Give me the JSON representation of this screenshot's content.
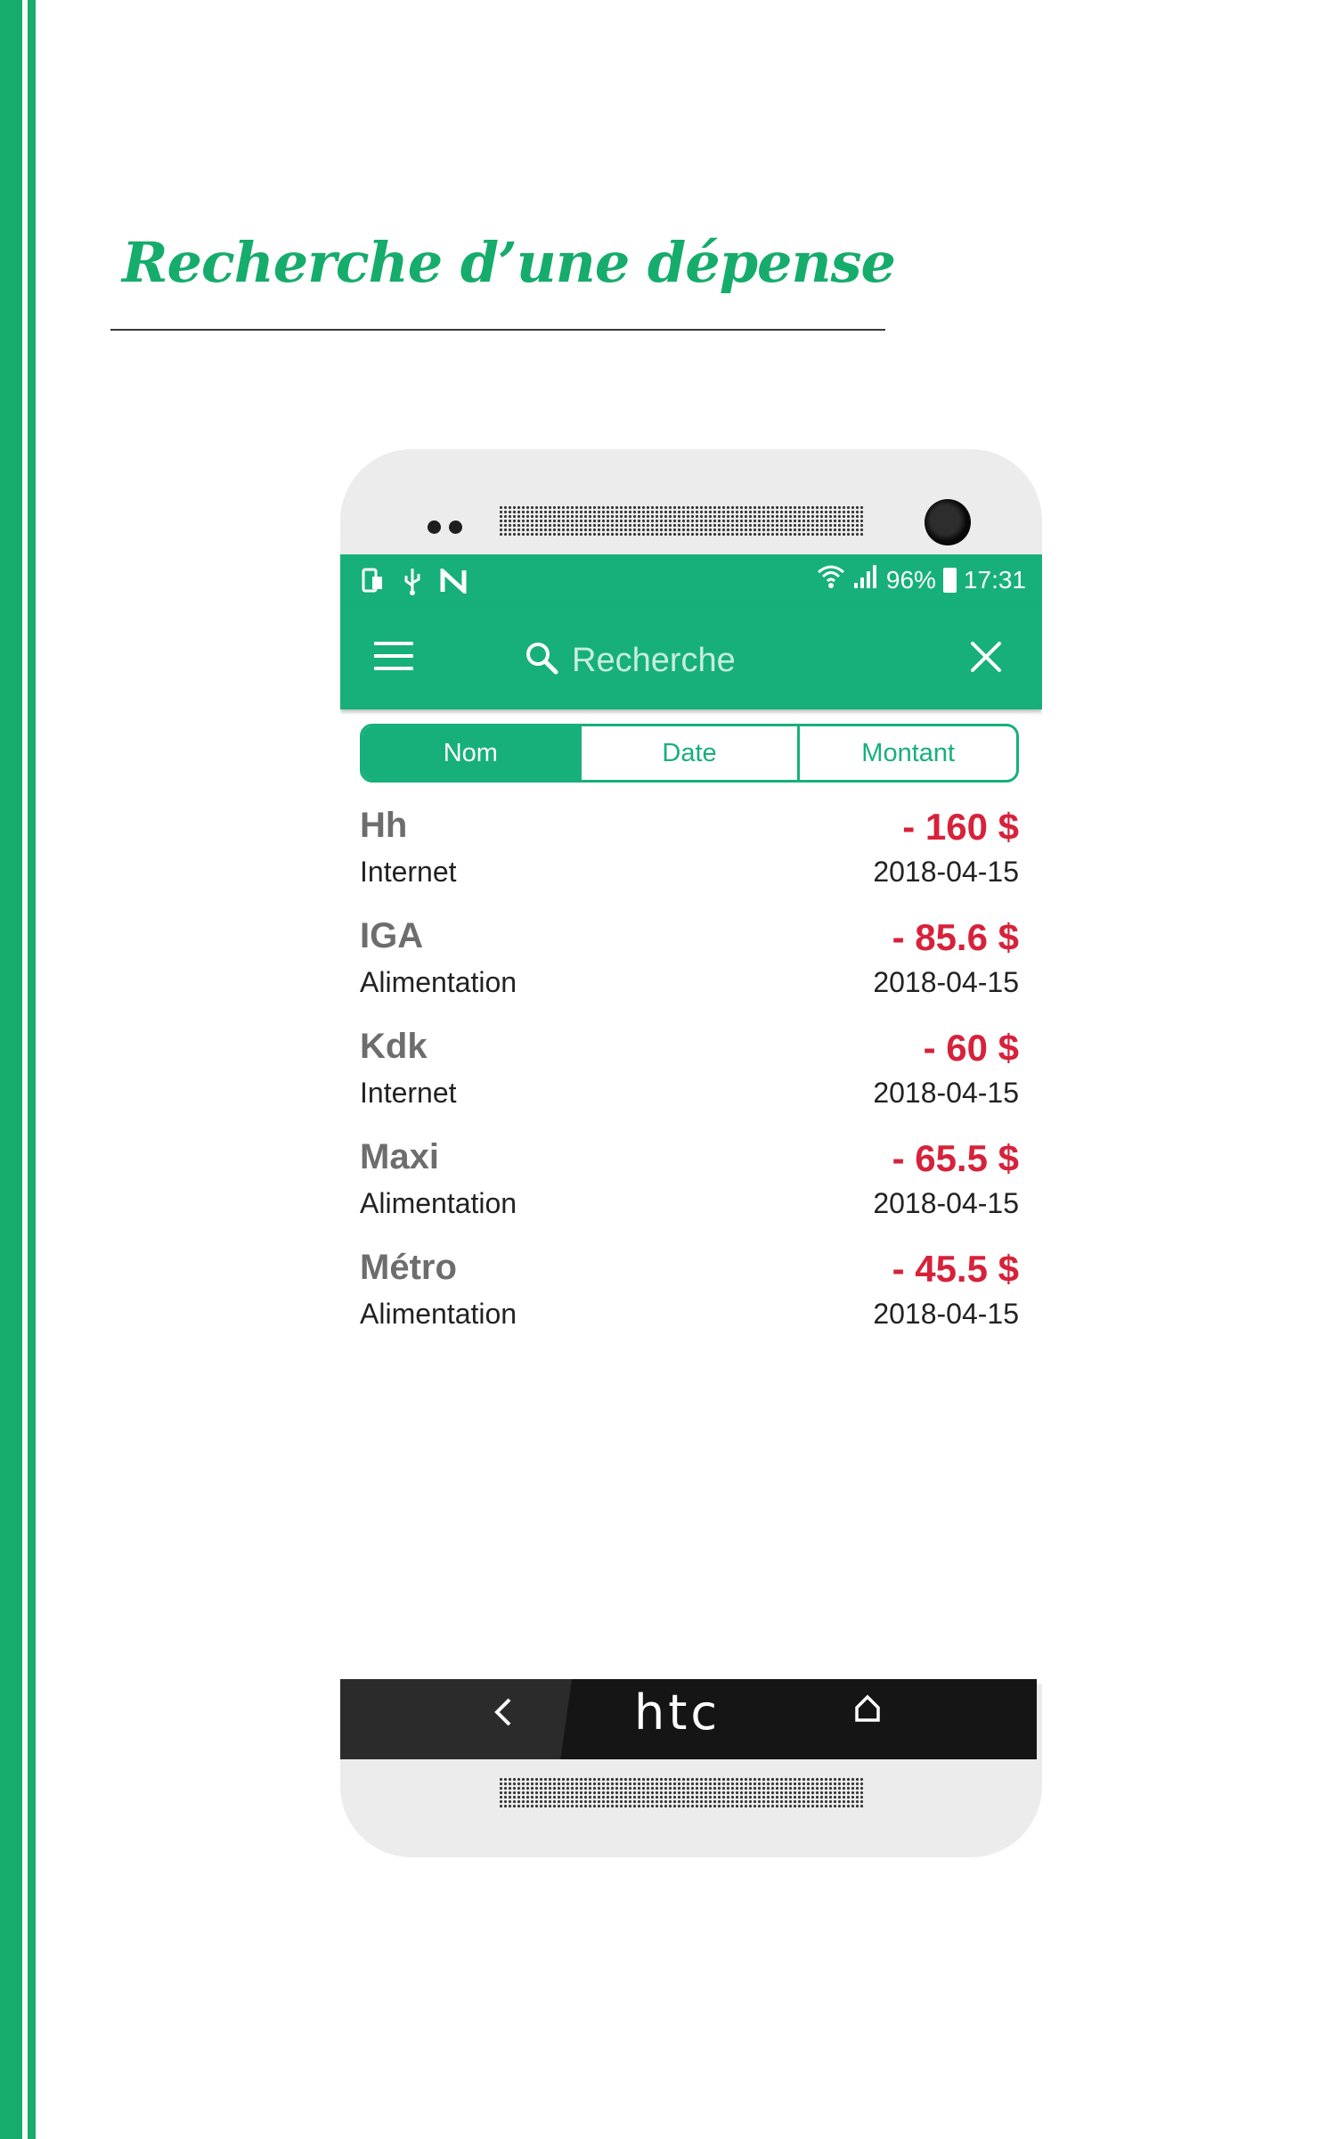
{
  "document": {
    "title": "Recherche d’une dépense"
  },
  "status_bar": {
    "battery": "96%",
    "time": "17:31"
  },
  "app_bar": {
    "search_placeholder": "Recherche"
  },
  "tabs": [
    {
      "label": "Nom",
      "active": true
    },
    {
      "label": "Date",
      "active": false
    },
    {
      "label": "Montant",
      "active": false
    }
  ],
  "expenses": [
    {
      "name": "Hh",
      "category": "Internet",
      "amount": "- 160 $",
      "date": "2018-04-15"
    },
    {
      "name": "IGA",
      "category": "Alimentation",
      "amount": "- 85.6 $",
      "date": "2018-04-15"
    },
    {
      "name": "Kdk",
      "category": "Internet",
      "amount": "- 60 $",
      "date": "2018-04-15"
    },
    {
      "name": "Maxi",
      "category": "Alimentation",
      "amount": "- 65.5 $",
      "date": "2018-04-15"
    },
    {
      "name": "Métro",
      "category": "Alimentation",
      "amount": "- 45.5 $",
      "date": "2018-04-15"
    }
  ],
  "device": {
    "brand": "htc"
  },
  "colors": {
    "primary": "#17b07a",
    "amount": "#d6223a",
    "border": "#16ac6c"
  },
  "icons": [
    "menu-icon",
    "search-icon",
    "close-icon",
    "back-icon",
    "home-icon",
    "wifi-icon",
    "signal-icon",
    "battery-icon",
    "usb-icon",
    "nfc-icon"
  ]
}
